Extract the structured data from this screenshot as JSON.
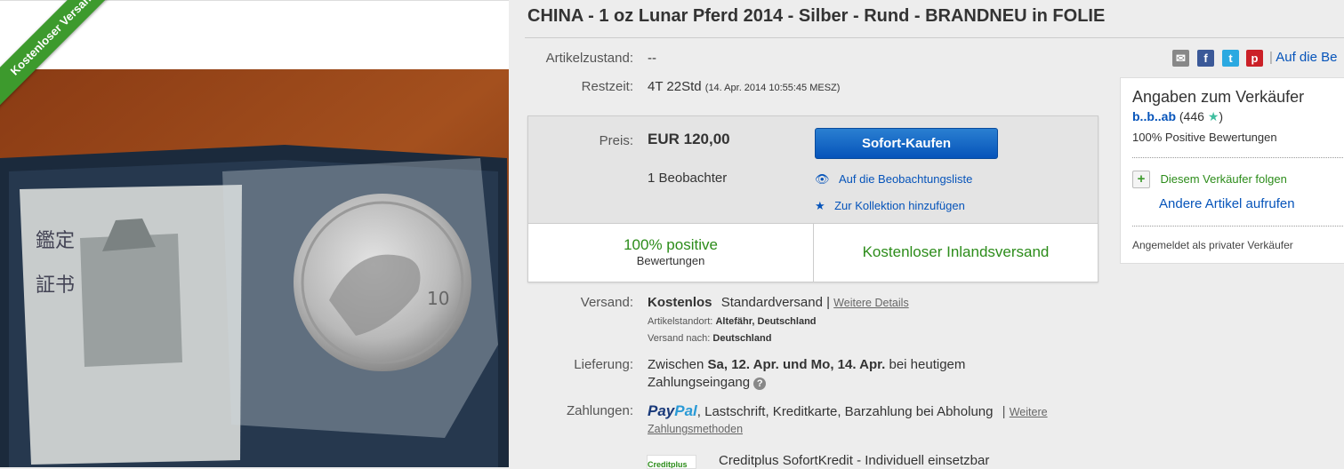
{
  "ribbon": "Kostenloser Versand",
  "title": "CHINA - 1 oz Lunar Pferd 2014 - Silber - Rund - BRANDNEU in FOLIE",
  "condition": {
    "label": "Artikelzustand:",
    "value": "--"
  },
  "time_left": {
    "label": "Restzeit:",
    "value": "4T 22Std",
    "end": "(14. Apr. 2014   10:55:45 MESZ)"
  },
  "share": {
    "link": "Auf die Be"
  },
  "buy": {
    "price_label": "Preis:",
    "price": "EUR 120,00",
    "watchers": "1 Beobachter",
    "button": "Sofort-Kaufen",
    "watchlist": "Auf die Beobachtungsliste",
    "collection": "Zur Kollektion hinzufügen",
    "positive_pct": "100% positive",
    "positive_sub": "Bewertungen",
    "free_shipping": "Kostenloser Inlandsversand"
  },
  "shipping": {
    "label": "Versand:",
    "cost": "Kostenlos",
    "service": "Standardversand |",
    "details": "Weitere Details",
    "location_label": "Artikelstandort:",
    "location": "Altefähr, Deutschland",
    "to_label": "Versand nach:",
    "to": "Deutschland"
  },
  "delivery": {
    "label": "Lieferung:",
    "pre": "Zwischen",
    "range": "Sa, 12. Apr. und Mo, 14. Apr.",
    "post": "bei heutigem",
    "line2": "Zahlungseingang"
  },
  "payment": {
    "label": "Zahlungen:",
    "paypal_a": "Pay",
    "paypal_b": "Pal",
    "methods": ", Lastschrift,  Kreditkarte,  Barzahlung bei Abholung",
    "sep": "|",
    "more_a": "Weitere",
    "more_b": "Zahlungsmethoden"
  },
  "credit": {
    "logo": "Creditplus",
    "text": "Creditplus SofortKredit - Individuell einsetzbar"
  },
  "seller": {
    "heading": "Angaben zum Verkäufer",
    "name": "b..b..ab",
    "score": "(446",
    "score_close": ")",
    "feedback": "100% Positive Bewertungen",
    "follow": "Diesem Verkäufer folgen",
    "other_items": "Andere Artikel aufrufen",
    "registered": "Angemeldet als privater Verkäufer"
  },
  "colors": {
    "accent_blue": "#0654ba",
    "green": "#2c8c1a",
    "ribbon_green": "#3d9a2d"
  }
}
